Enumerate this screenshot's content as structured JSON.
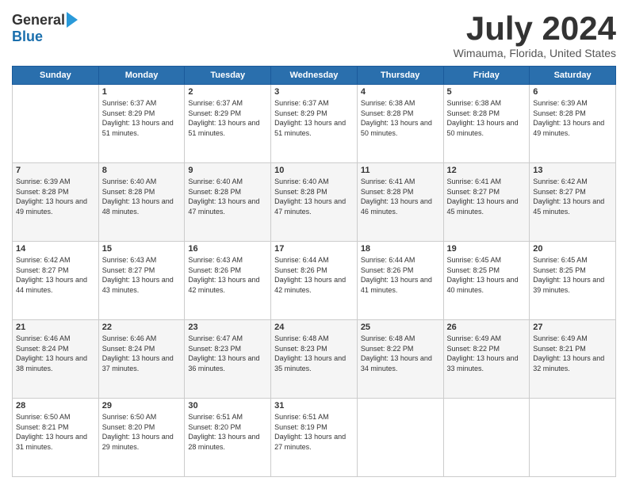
{
  "logo": {
    "general": "General",
    "blue": "Blue"
  },
  "title": {
    "month": "July 2024",
    "location": "Wimauma, Florida, United States"
  },
  "weekdays": [
    "Sunday",
    "Monday",
    "Tuesday",
    "Wednesday",
    "Thursday",
    "Friday",
    "Saturday"
  ],
  "weeks": [
    [
      {
        "day": "",
        "sunrise": "",
        "sunset": "",
        "daylight": ""
      },
      {
        "day": "1",
        "sunrise": "Sunrise: 6:37 AM",
        "sunset": "Sunset: 8:29 PM",
        "daylight": "Daylight: 13 hours and 51 minutes."
      },
      {
        "day": "2",
        "sunrise": "Sunrise: 6:37 AM",
        "sunset": "Sunset: 8:29 PM",
        "daylight": "Daylight: 13 hours and 51 minutes."
      },
      {
        "day": "3",
        "sunrise": "Sunrise: 6:37 AM",
        "sunset": "Sunset: 8:29 PM",
        "daylight": "Daylight: 13 hours and 51 minutes."
      },
      {
        "day": "4",
        "sunrise": "Sunrise: 6:38 AM",
        "sunset": "Sunset: 8:28 PM",
        "daylight": "Daylight: 13 hours and 50 minutes."
      },
      {
        "day": "5",
        "sunrise": "Sunrise: 6:38 AM",
        "sunset": "Sunset: 8:28 PM",
        "daylight": "Daylight: 13 hours and 50 minutes."
      },
      {
        "day": "6",
        "sunrise": "Sunrise: 6:39 AM",
        "sunset": "Sunset: 8:28 PM",
        "daylight": "Daylight: 13 hours and 49 minutes."
      }
    ],
    [
      {
        "day": "7",
        "sunrise": "Sunrise: 6:39 AM",
        "sunset": "Sunset: 8:28 PM",
        "daylight": "Daylight: 13 hours and 49 minutes."
      },
      {
        "day": "8",
        "sunrise": "Sunrise: 6:40 AM",
        "sunset": "Sunset: 8:28 PM",
        "daylight": "Daylight: 13 hours and 48 minutes."
      },
      {
        "day": "9",
        "sunrise": "Sunrise: 6:40 AM",
        "sunset": "Sunset: 8:28 PM",
        "daylight": "Daylight: 13 hours and 47 minutes."
      },
      {
        "day": "10",
        "sunrise": "Sunrise: 6:40 AM",
        "sunset": "Sunset: 8:28 PM",
        "daylight": "Daylight: 13 hours and 47 minutes."
      },
      {
        "day": "11",
        "sunrise": "Sunrise: 6:41 AM",
        "sunset": "Sunset: 8:28 PM",
        "daylight": "Daylight: 13 hours and 46 minutes."
      },
      {
        "day": "12",
        "sunrise": "Sunrise: 6:41 AM",
        "sunset": "Sunset: 8:27 PM",
        "daylight": "Daylight: 13 hours and 45 minutes."
      },
      {
        "day": "13",
        "sunrise": "Sunrise: 6:42 AM",
        "sunset": "Sunset: 8:27 PM",
        "daylight": "Daylight: 13 hours and 45 minutes."
      }
    ],
    [
      {
        "day": "14",
        "sunrise": "Sunrise: 6:42 AM",
        "sunset": "Sunset: 8:27 PM",
        "daylight": "Daylight: 13 hours and 44 minutes."
      },
      {
        "day": "15",
        "sunrise": "Sunrise: 6:43 AM",
        "sunset": "Sunset: 8:27 PM",
        "daylight": "Daylight: 13 hours and 43 minutes."
      },
      {
        "day": "16",
        "sunrise": "Sunrise: 6:43 AM",
        "sunset": "Sunset: 8:26 PM",
        "daylight": "Daylight: 13 hours and 42 minutes."
      },
      {
        "day": "17",
        "sunrise": "Sunrise: 6:44 AM",
        "sunset": "Sunset: 8:26 PM",
        "daylight": "Daylight: 13 hours and 42 minutes."
      },
      {
        "day": "18",
        "sunrise": "Sunrise: 6:44 AM",
        "sunset": "Sunset: 8:26 PM",
        "daylight": "Daylight: 13 hours and 41 minutes."
      },
      {
        "day": "19",
        "sunrise": "Sunrise: 6:45 AM",
        "sunset": "Sunset: 8:25 PM",
        "daylight": "Daylight: 13 hours and 40 minutes."
      },
      {
        "day": "20",
        "sunrise": "Sunrise: 6:45 AM",
        "sunset": "Sunset: 8:25 PM",
        "daylight": "Daylight: 13 hours and 39 minutes."
      }
    ],
    [
      {
        "day": "21",
        "sunrise": "Sunrise: 6:46 AM",
        "sunset": "Sunset: 8:24 PM",
        "daylight": "Daylight: 13 hours and 38 minutes."
      },
      {
        "day": "22",
        "sunrise": "Sunrise: 6:46 AM",
        "sunset": "Sunset: 8:24 PM",
        "daylight": "Daylight: 13 hours and 37 minutes."
      },
      {
        "day": "23",
        "sunrise": "Sunrise: 6:47 AM",
        "sunset": "Sunset: 8:23 PM",
        "daylight": "Daylight: 13 hours and 36 minutes."
      },
      {
        "day": "24",
        "sunrise": "Sunrise: 6:48 AM",
        "sunset": "Sunset: 8:23 PM",
        "daylight": "Daylight: 13 hours and 35 minutes."
      },
      {
        "day": "25",
        "sunrise": "Sunrise: 6:48 AM",
        "sunset": "Sunset: 8:22 PM",
        "daylight": "Daylight: 13 hours and 34 minutes."
      },
      {
        "day": "26",
        "sunrise": "Sunrise: 6:49 AM",
        "sunset": "Sunset: 8:22 PM",
        "daylight": "Daylight: 13 hours and 33 minutes."
      },
      {
        "day": "27",
        "sunrise": "Sunrise: 6:49 AM",
        "sunset": "Sunset: 8:21 PM",
        "daylight": "Daylight: 13 hours and 32 minutes."
      }
    ],
    [
      {
        "day": "28",
        "sunrise": "Sunrise: 6:50 AM",
        "sunset": "Sunset: 8:21 PM",
        "daylight": "Daylight: 13 hours and 31 minutes."
      },
      {
        "day": "29",
        "sunrise": "Sunrise: 6:50 AM",
        "sunset": "Sunset: 8:20 PM",
        "daylight": "Daylight: 13 hours and 29 minutes."
      },
      {
        "day": "30",
        "sunrise": "Sunrise: 6:51 AM",
        "sunset": "Sunset: 8:20 PM",
        "daylight": "Daylight: 13 hours and 28 minutes."
      },
      {
        "day": "31",
        "sunrise": "Sunrise: 6:51 AM",
        "sunset": "Sunset: 8:19 PM",
        "daylight": "Daylight: 13 hours and 27 minutes."
      },
      {
        "day": "",
        "sunrise": "",
        "sunset": "",
        "daylight": ""
      },
      {
        "day": "",
        "sunrise": "",
        "sunset": "",
        "daylight": ""
      },
      {
        "day": "",
        "sunrise": "",
        "sunset": "",
        "daylight": ""
      }
    ]
  ]
}
